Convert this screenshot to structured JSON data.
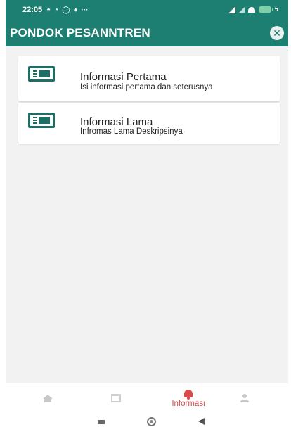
{
  "status_bar": {
    "time": "22:05",
    "icons": [
      "notification-icon",
      "notification-icon",
      "whatsapp-icon",
      "facebook-icon"
    ],
    "more": "···"
  },
  "app_bar": {
    "title": "PONDOK PESANNTREN",
    "close_icon": "close-icon"
  },
  "list": {
    "items": [
      {
        "title": "Informasi Pertama",
        "description": "Isi informasi pertama dan seterusnya",
        "icon": "newspaper-icon"
      },
      {
        "title": "Informasi Lama",
        "description": "Infromas Lama Deskripsinya",
        "icon": "newspaper-icon"
      }
    ]
  },
  "bottom_nav": {
    "items": [
      {
        "icon": "home-icon",
        "label": ""
      },
      {
        "icon": "calendar-icon",
        "label": ""
      },
      {
        "icon": "bell-icon",
        "label": "Informasi",
        "active": true
      },
      {
        "icon": "profile-icon",
        "label": ""
      }
    ]
  },
  "colors": {
    "primary": "#1d7f71",
    "active": "#d94a4a",
    "background": "#f2f2f2"
  }
}
